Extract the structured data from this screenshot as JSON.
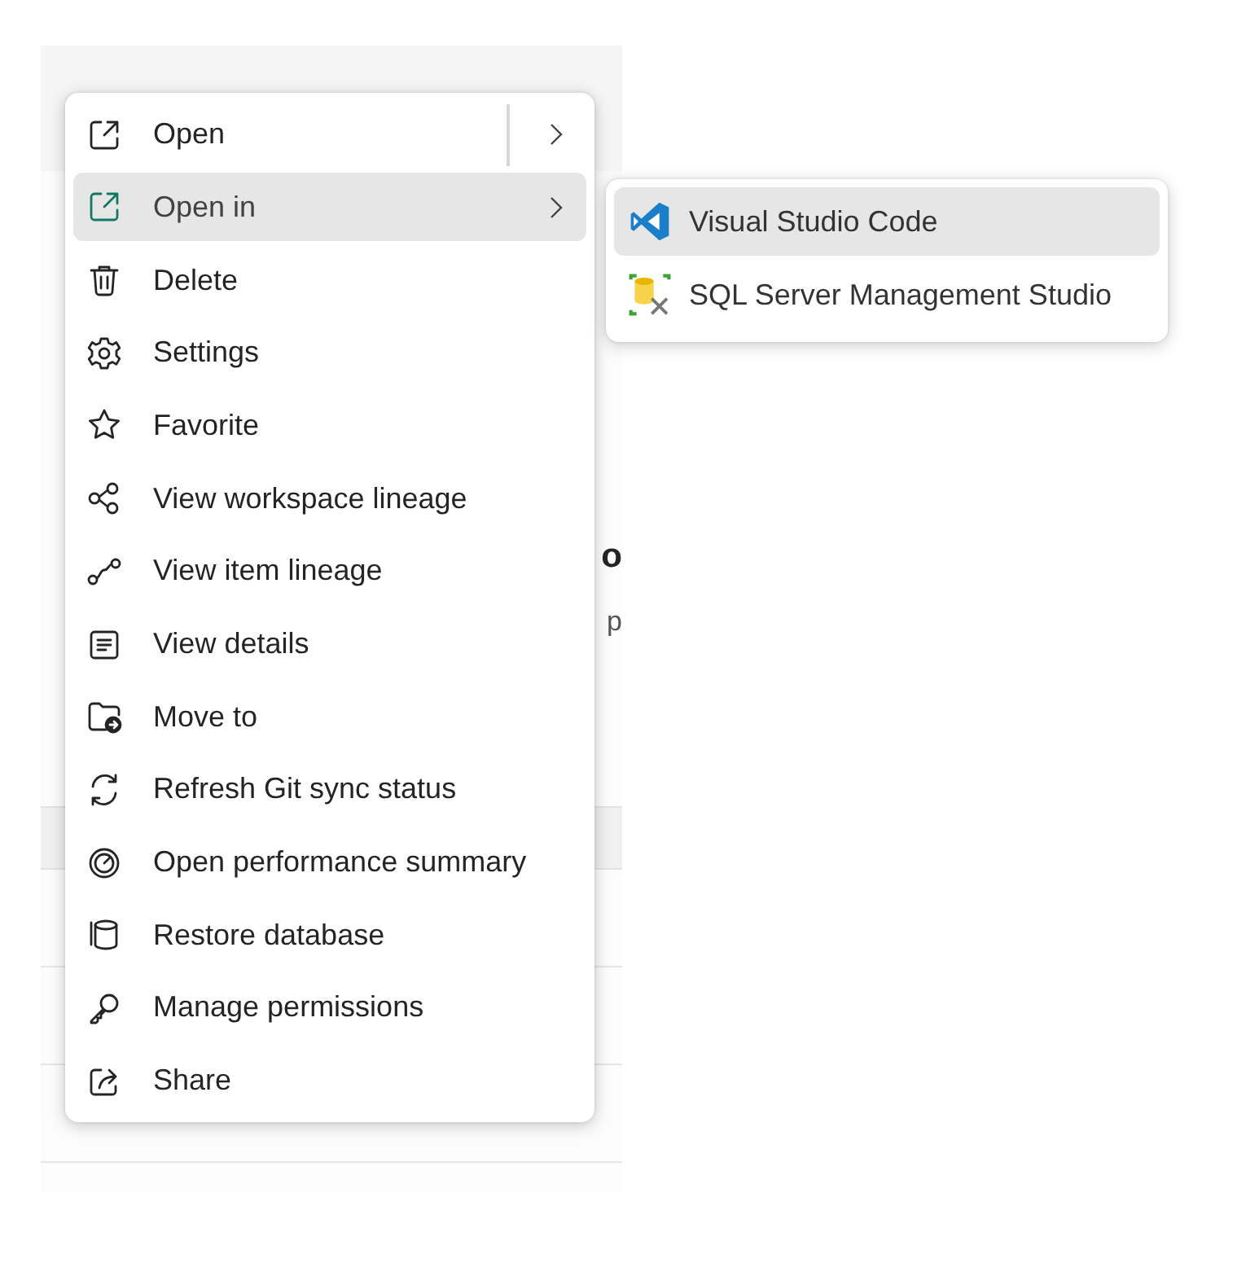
{
  "page_behind": {
    "heading_fragment": "o",
    "text_fragment": "p"
  },
  "menu": {
    "items": [
      {
        "label": "Open",
        "kind": "split",
        "selected": false
      },
      {
        "label": "Open in",
        "kind": "submenu",
        "selected": true
      },
      {
        "label": "Delete",
        "kind": "plain",
        "selected": false
      },
      {
        "label": "Settings",
        "kind": "plain",
        "selected": false
      },
      {
        "label": "Favorite",
        "kind": "plain",
        "selected": false
      },
      {
        "label": "View workspace lineage",
        "kind": "plain",
        "selected": false
      },
      {
        "label": "View item lineage",
        "kind": "plain",
        "selected": false
      },
      {
        "label": "View details",
        "kind": "plain",
        "selected": false
      },
      {
        "label": "Move to",
        "kind": "plain",
        "selected": false
      },
      {
        "label": "Refresh Git sync status",
        "kind": "plain",
        "selected": false
      },
      {
        "label": "Open performance summary",
        "kind": "plain",
        "selected": false
      },
      {
        "label": "Restore database",
        "kind": "plain",
        "selected": false
      },
      {
        "label": "Manage permissions",
        "kind": "plain",
        "selected": false
      },
      {
        "label": "Share",
        "kind": "plain",
        "selected": false
      }
    ]
  },
  "submenu": {
    "items": [
      {
        "label": "Visual Studio Code",
        "selected": true
      },
      {
        "label": "SQL Server Management Studio",
        "selected": false
      }
    ]
  }
}
